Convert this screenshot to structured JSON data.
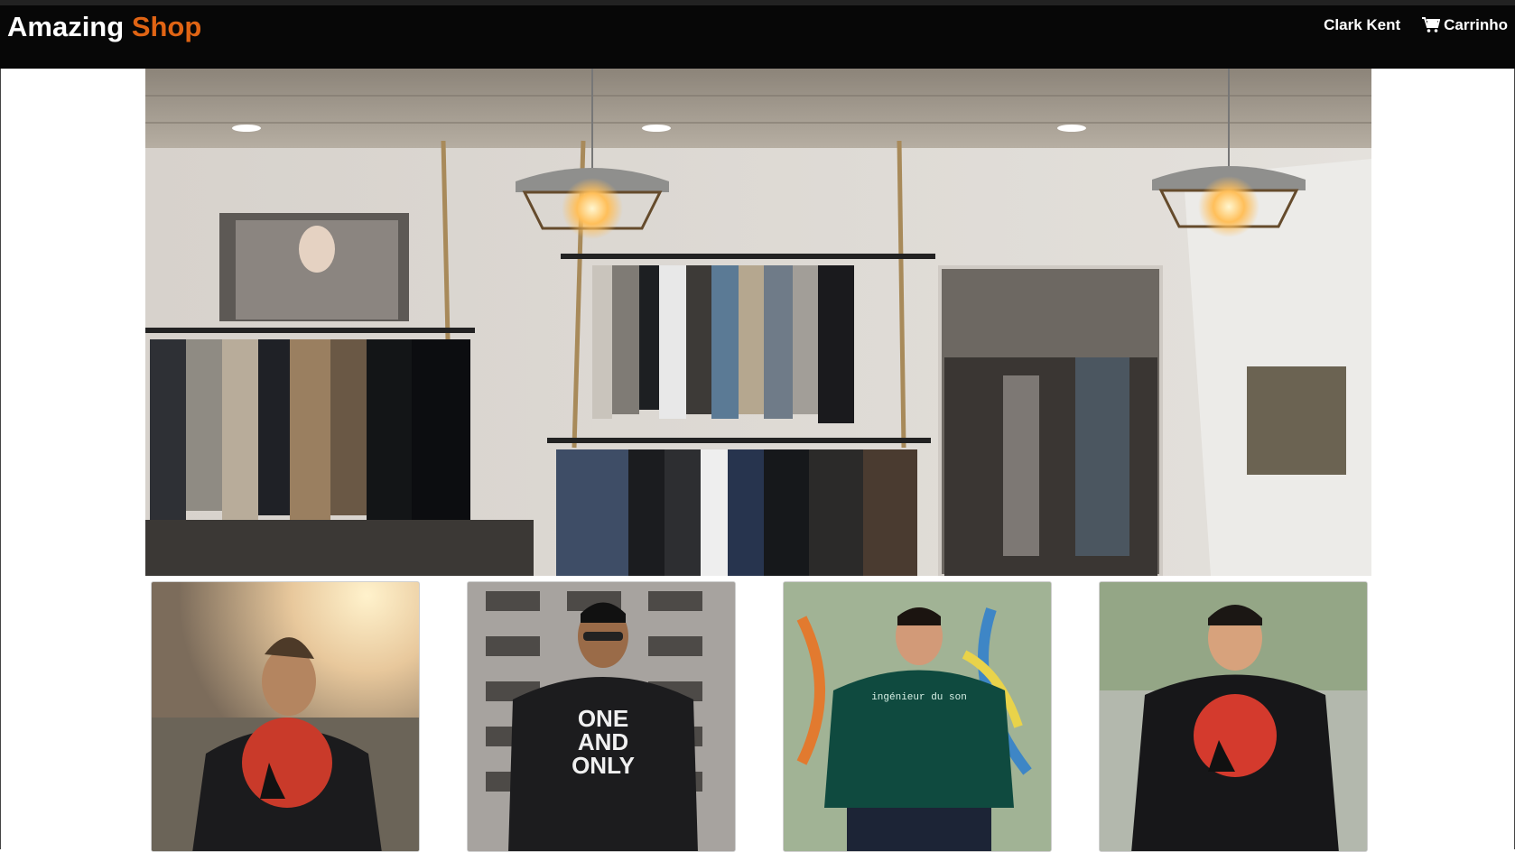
{
  "brand": {
    "first": "Amazing",
    "second": "Shop"
  },
  "nav": {
    "user": "Clark Kent",
    "cart": "Carrinho"
  },
  "products": [
    {
      "shirt_text": ""
    },
    {
      "shirt_text_lines": [
        "ONE",
        "AND",
        "ONLY"
      ]
    },
    {
      "shirt_text": "ingénieur du son"
    },
    {
      "shirt_text": ""
    }
  ]
}
